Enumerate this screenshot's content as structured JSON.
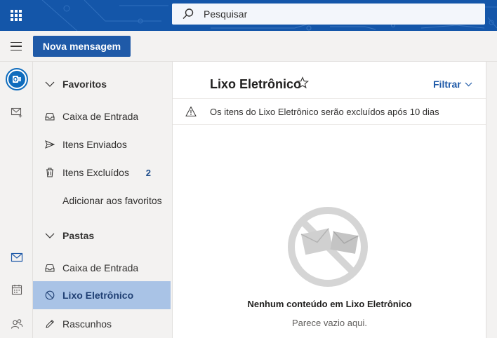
{
  "topbar": {
    "search_placeholder": "Pesquisar"
  },
  "command_bar": {
    "new_message_label": "Nova mensagem"
  },
  "folder_pane": {
    "favorites_header": "Favoritos",
    "favorites": [
      {
        "label": "Caixa de Entrada",
        "icon": "inbox-icon"
      },
      {
        "label": "Itens Enviados",
        "icon": "send-icon"
      },
      {
        "label": "Itens Excluídos",
        "icon": "trash-icon",
        "count": "2"
      }
    ],
    "add_favorites_label": "Adicionar aos favoritos",
    "folders_header": "Pastas",
    "folders": [
      {
        "label": "Caixa de Entrada",
        "icon": "inbox-icon"
      },
      {
        "label": "Lixo Eletrônico",
        "icon": "blocked-icon",
        "selected": true
      },
      {
        "label": "Rascunhos",
        "icon": "pencil-icon"
      }
    ]
  },
  "message_list": {
    "title": "Lixo Eletrônico",
    "filter_label": "Filtrar",
    "notice": "Os itens do Lixo Eletrônico serão excluídos após 10 dias",
    "empty_title": "Nenhum conteúdo em Lixo Eletrônico",
    "empty_subtitle": "Parece vazio aqui."
  },
  "colors": {
    "brand": "#1456a9",
    "accent": "#1f5aa8",
    "selected_folder": "#a9c3e6"
  }
}
